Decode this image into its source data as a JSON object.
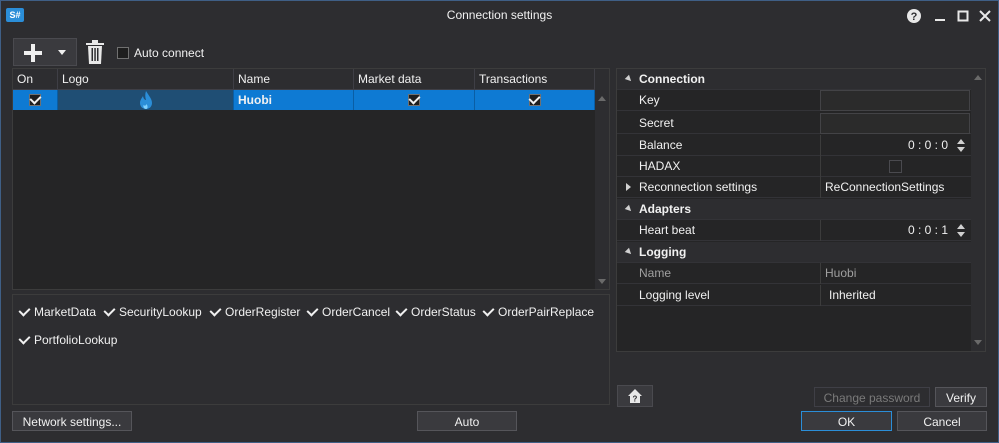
{
  "window": {
    "title": "Connection settings",
    "app_icon": "S#"
  },
  "toolbar": {
    "add_icon": "plus-icon",
    "delete_icon": "trash-icon",
    "auto_connect_label": "Auto connect",
    "auto_connect_checked": false
  },
  "grid": {
    "columns": [
      "On",
      "Logo",
      "Name",
      "Market data",
      "Transactions"
    ],
    "rows": [
      {
        "on": true,
        "logo": "huobi-logo-icon",
        "name": "Huobi",
        "market_data": true,
        "transactions": true
      }
    ]
  },
  "messages": [
    {
      "label": "MarketData",
      "checked": true
    },
    {
      "label": "SecurityLookup",
      "checked": true
    },
    {
      "label": "OrderRegister",
      "checked": true
    },
    {
      "label": "OrderCancel",
      "checked": true
    },
    {
      "label": "OrderStatus",
      "checked": true
    },
    {
      "label": "OrderPairReplace",
      "checked": true
    },
    {
      "label": "PortfolioLookup",
      "checked": true
    }
  ],
  "properties": {
    "connection": {
      "title": "Connection",
      "key_label": "Key",
      "key_value": "",
      "secret_label": "Secret",
      "secret_value": "",
      "balance_label": "Balance",
      "balance_value": "0 : 0 : 0",
      "hadax_label": "HADAX",
      "hadax_checked": false,
      "reconnection_label": "Reconnection settings",
      "reconnection_value": "ReConnectionSettings"
    },
    "adapters": {
      "title": "Adapters",
      "heartbeat_label": "Heart beat",
      "heartbeat_value": "0 : 0 : 1"
    },
    "logging": {
      "title": "Logging",
      "name_label": "Name",
      "name_value": "Huobi",
      "level_label": "Logging level",
      "level_value": "Inherited"
    }
  },
  "buttons": {
    "change_password": "Change password",
    "verify": "Verify",
    "network_settings": "Network settings...",
    "auto": "Auto",
    "ok": "OK",
    "cancel": "Cancel"
  },
  "colors": {
    "accent": "#0e7ad3",
    "background": "#2d2d30",
    "huobi_logo": "#2b8ed8"
  }
}
